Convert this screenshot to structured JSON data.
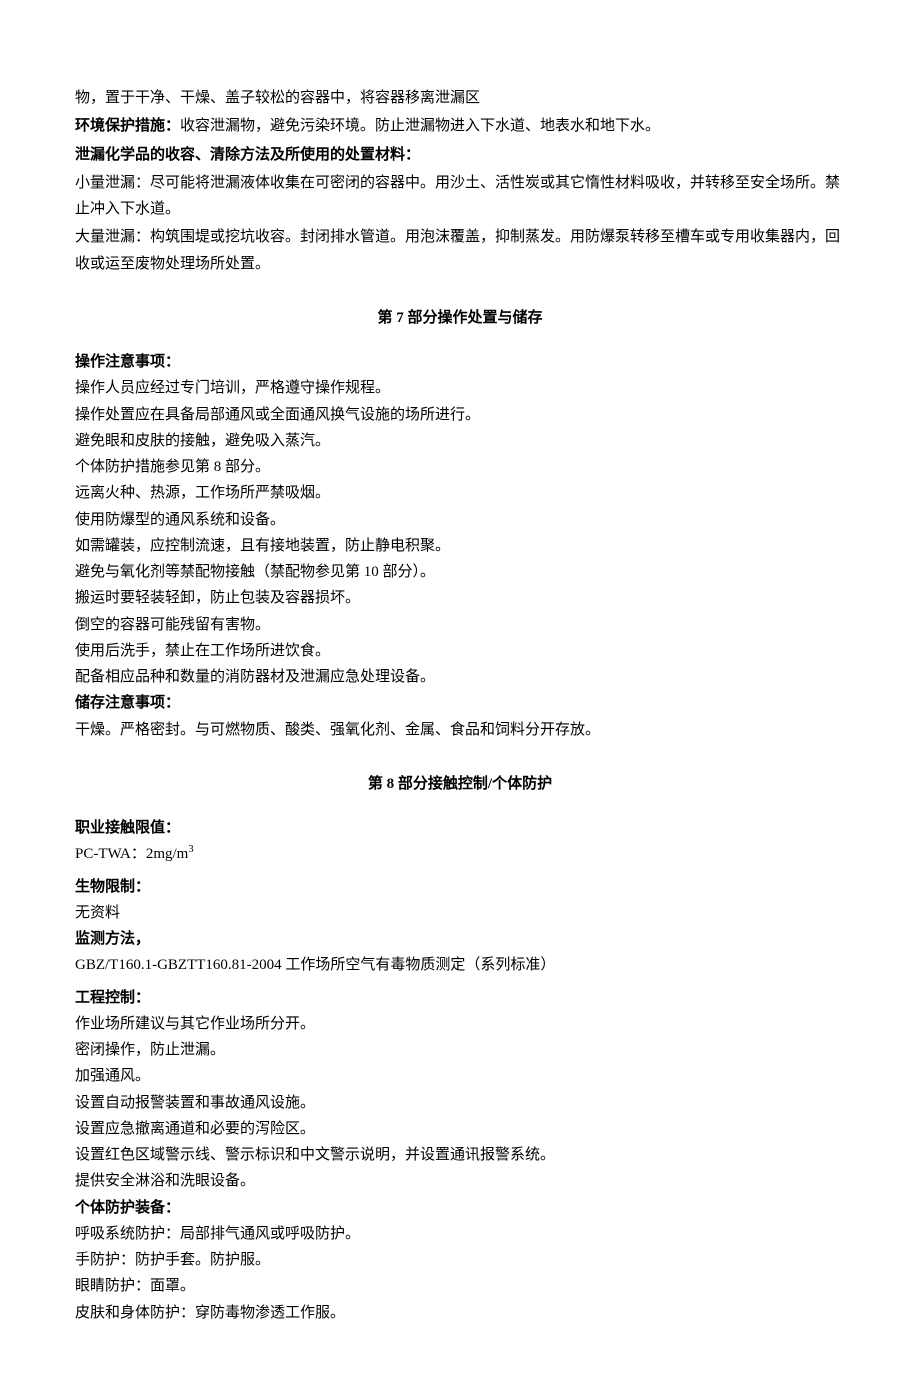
{
  "section6": {
    "line1": "物，置于干净、干燥、盖子较松的容器中，将容器移离泄漏区",
    "envLabel": "环境保护措施：",
    "envText": "收容泄漏物，避免污染环境。防止泄漏物进入下水道、地表水和地下水。",
    "cleanupLabel": "泄漏化学品的收容、清除方法及所使用的处置材料：",
    "smallLeak": "小量泄漏：尽可能将泄漏液体收集在可密闭的容器中。用沙土、活性炭或其它惰性材料吸收，并转移至安全场所。禁止冲入下水道。",
    "largeLeak": "大量泄漏：构筑围堤或挖坑收容。封闭排水管道。用泡沫覆盖，抑制蒸发。用防爆泵转移至槽车或专用收集器内，回收或运至废物处理场所处置。"
  },
  "section7": {
    "title": "第 7 部分操作处置与储存",
    "opLabel": "操作注意事项：",
    "op": [
      "操作人员应经过专门培训，严格遵守操作规程。",
      "操作处置应在具备局部通风或全面通风换气设施的场所进行。",
      "避免眼和皮肤的接触，避免吸入蒸汽。",
      "个体防护措施参见第 8 部分。",
      "远离火种、热源，工作场所严禁吸烟。",
      "使用防爆型的通风系统和设备。",
      "如需罐装，应控制流速，且有接地装置，防止静电积聚。",
      "避免与氧化剂等禁配物接触（禁配物参见第 10 部分）。",
      "搬运时要轻装轻卸，防止包装及容器损坏。",
      "倒空的容器可能残留有害物。",
      "使用后洗手，禁止在工作场所进饮食。",
      "配备相应品种和数量的消防器材及泄漏应急处理设备。"
    ],
    "storeLabel": "储存注意事项：",
    "storeText": "干燥。严格密封。与可燃物质、酸类、强氧化剂、金属、食品和饲料分开存放。"
  },
  "section8": {
    "title": "第 8 部分接触控制/个体防护",
    "occLabel": "职业接触限值：",
    "pctwa_prefix": "PC-TWA：2mg/m",
    "pctwa_sup": "3",
    "bioLabel": "生物限制：",
    "bioText": "无资料",
    "monLabel": "监测方法，",
    "monText": "GBZ/T160.1-GBZTT160.81-2004 工作场所空气有毒物质测定（系列标准）",
    "engLabel": "工程控制：",
    "eng": [
      "作业场所建议与其它作业场所分开。",
      "密闭操作，防止泄漏。",
      "加强通风。",
      "设置自动报警装置和事故通风设施。",
      "设置应急撤离通道和必要的泻险区。",
      "设置红色区域警示线、警示标识和中文警示说明，并设置通讯报警系统。",
      "提供安全淋浴和洗眼设备。"
    ],
    "ppeLabel": "个体防护装备：",
    "ppe": [
      "呼吸系统防护：局部排气通风或呼吸防护。",
      "手防护：防护手套。防护服。",
      "眼睛防护：面罩。",
      "皮肤和身体防护：穿防毒物渗透工作服。"
    ]
  }
}
